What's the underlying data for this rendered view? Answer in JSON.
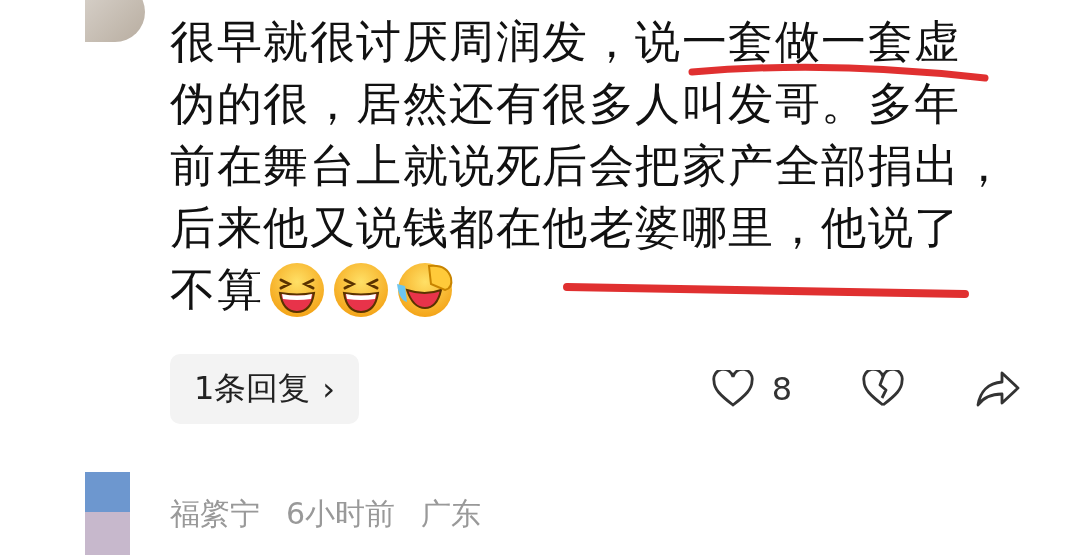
{
  "comment": {
    "lines": [
      "很早就很讨厌周润发，说一套做一套虚",
      "伪的很，居然还有很多人叫发哥。多年",
      "前在舞台上就说死后会把家产全部捐出，",
      "后来他又说钱都在他老婆哪里，他说了",
      "不算"
    ],
    "emojis": [
      {
        "kind": "laugh"
      },
      {
        "kind": "laugh"
      },
      {
        "kind": "facepalm"
      }
    ],
    "replies": "1条回复",
    "replies_arrow": "›",
    "likes": "8"
  },
  "next_comment": {
    "author": "福綮宁",
    "time": "6小时前",
    "location": "广东"
  }
}
